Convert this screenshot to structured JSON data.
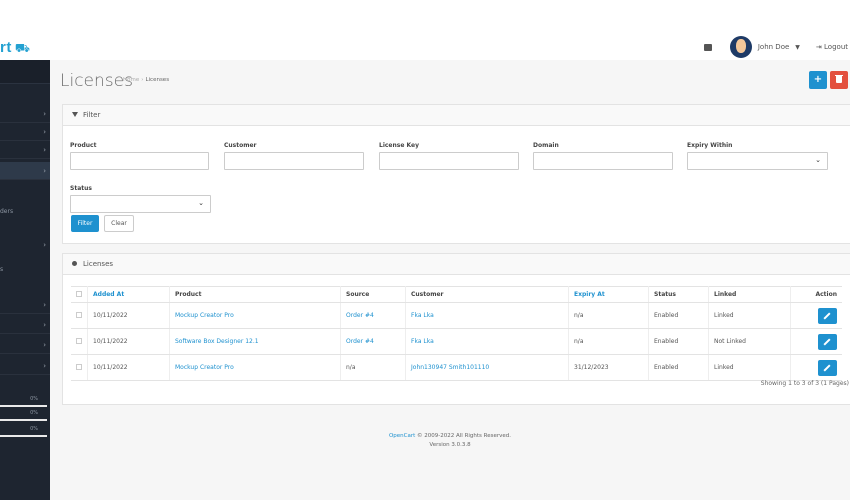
{
  "header": {
    "logo_text": "rt",
    "user_name": "John Doe",
    "logout_label": "Logout"
  },
  "sidebar": {
    "partial_labels": [
      "ders",
      "s"
    ],
    "progress": [
      {
        "label": "0%",
        "value": 0
      },
      {
        "label": "0%",
        "value": 0
      },
      {
        "label": "0%",
        "value": 0
      }
    ]
  },
  "page": {
    "title": "Licenses",
    "breadcrumb": [
      "Home",
      "Licenses"
    ]
  },
  "filter": {
    "heading": "Filter",
    "fields": {
      "product": "Product",
      "customer": "Customer",
      "license_key": "License Key",
      "domain": "Domain",
      "expiry_within": "Expiry Within",
      "status": "Status"
    },
    "filter_button": "Filter",
    "clear_button": "Clear"
  },
  "licenses": {
    "heading": "Licenses",
    "columns": [
      "Added At",
      "Product",
      "Source",
      "Customer",
      "Expiry At",
      "Status",
      "Linked",
      "Action"
    ],
    "rows": [
      {
        "added": "10/11/2022",
        "product": "Mockup Creator Pro",
        "source": "Order #4",
        "customer": "Fka Lka",
        "expiry": "n/a",
        "status": "Enabled",
        "linked": "Linked"
      },
      {
        "added": "10/11/2022",
        "product": "Software Box Designer 12.1",
        "source": "Order #4",
        "customer": "Fka Lka",
        "expiry": "n/a",
        "status": "Enabled",
        "linked": "Not Linked"
      },
      {
        "added": "10/11/2022",
        "product": "Mockup Creator Pro",
        "source": "n/a",
        "customer": "John130947 Smith101110",
        "expiry": "31/12/2023",
        "status": "Enabled",
        "linked": "Linked"
      }
    ],
    "showing": "Showing 1 to 3 of 3 (1 Pages)"
  },
  "footer": {
    "brand": "OpenCart",
    "copyright": "© 2009-2022 All Rights Reserved.",
    "version": "Version 3.0.3.8"
  },
  "colors": {
    "accent": "#1e91cf",
    "danger": "#e3503e",
    "sidebar_bg": "#1e2530"
  }
}
